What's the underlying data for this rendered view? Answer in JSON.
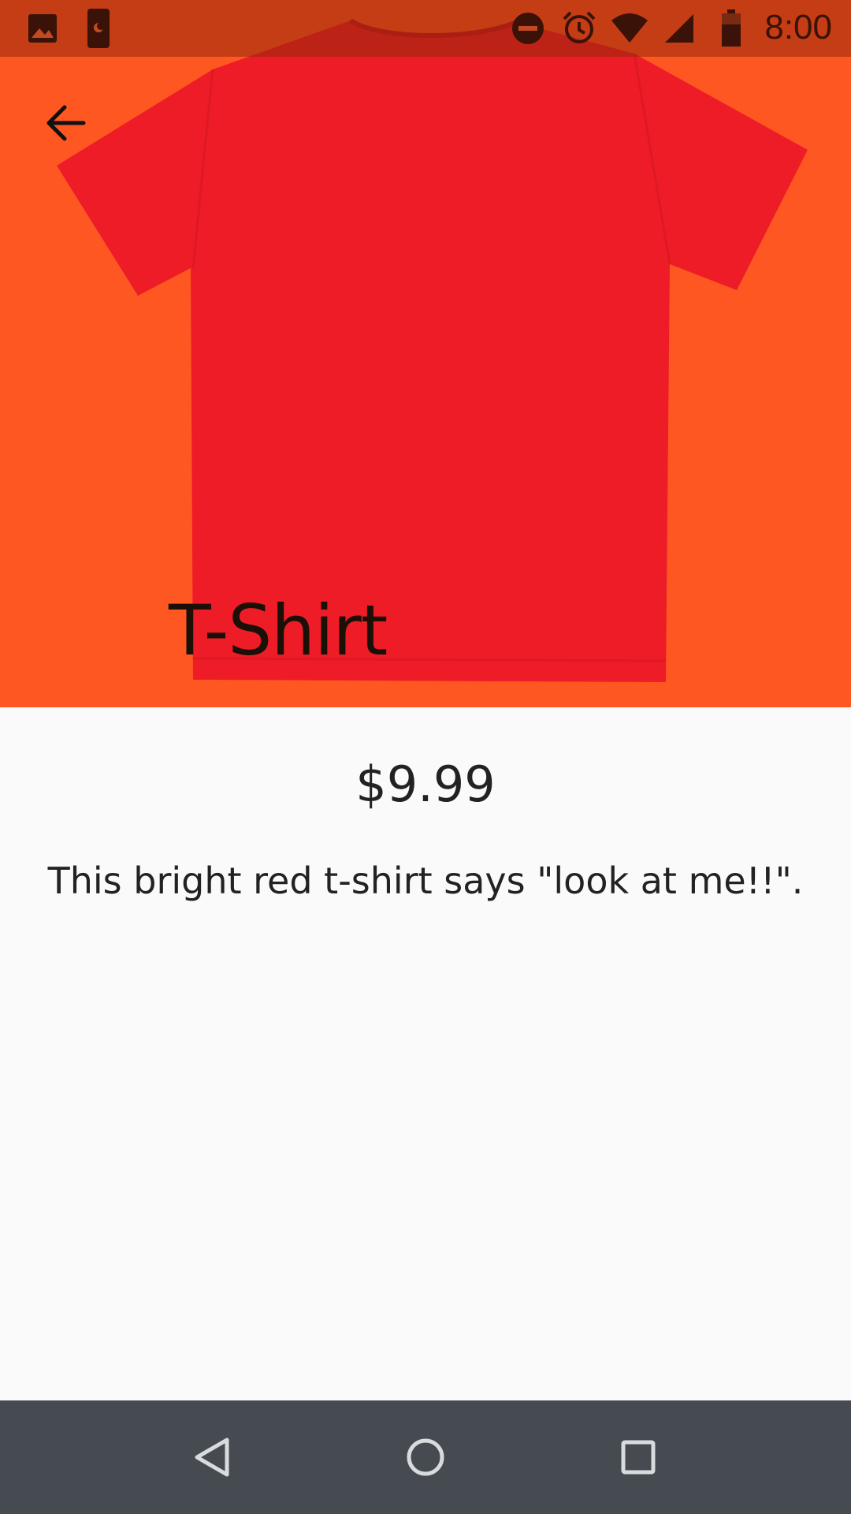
{
  "status_bar": {
    "time": "8:00",
    "left_icons": [
      "image-icon",
      "phone-dnd-icon"
    ],
    "right_icons": [
      "do-not-disturb-icon",
      "alarm-icon",
      "wifi-icon",
      "cellular-signal-icon",
      "battery-icon"
    ]
  },
  "product": {
    "title": "T-Shirt",
    "price": "$9.99",
    "description": "This bright red t-shirt says \"look at me!!\".",
    "image": "red-tshirt-image"
  },
  "colors": {
    "hero_background": "#ff5722",
    "status_bar_tint": "#bf360c",
    "shirt_red": "#ee1c27",
    "page_background": "#fafafa",
    "nav_bar": "#454b50"
  },
  "nav": {
    "back": "back-icon",
    "home": "home-icon",
    "recents": "recents-icon"
  }
}
